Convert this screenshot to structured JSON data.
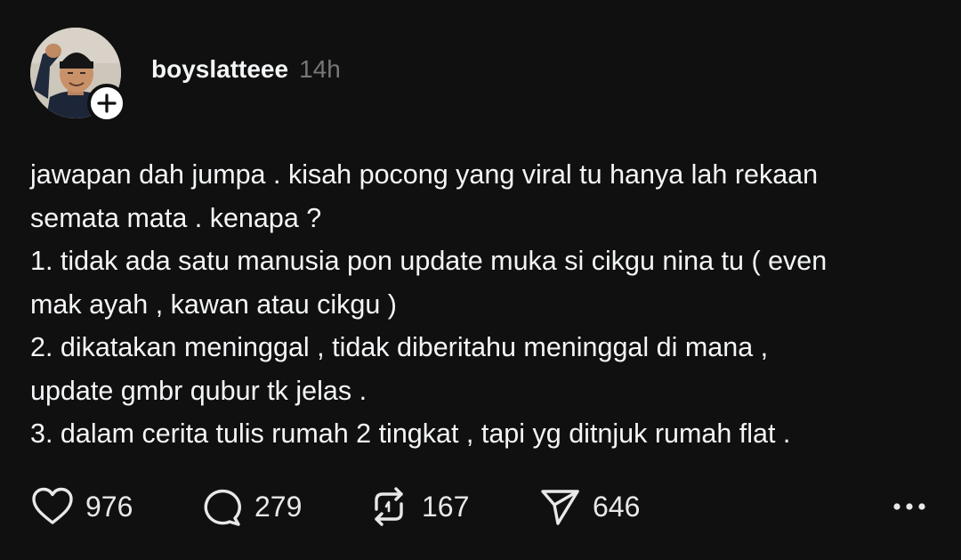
{
  "post": {
    "author": {
      "username": "boyslatteee",
      "time": "14h",
      "avatar_icon": "profile-photo",
      "follow_icon": "plus-icon"
    },
    "content": {
      "lines": [
        "jawapan dah jumpa . kisah pocong yang viral tu hanya lah rekaan",
        "semata mata . kenapa ?",
        "1. tidak ada satu manusia pon update muka si cikgu nina tu ( even",
        "mak ayah , kawan atau cikgu )",
        "2. dikatakan meninggal , tidak diberitahu meninggal di mana ,",
        "update gmbr qubur tk jelas .",
        "3. dalam cerita tulis rumah 2 tingkat , tapi yg ditnjuk rumah flat ."
      ]
    },
    "actions": {
      "likes": "976",
      "replies": "279",
      "reposts": "167",
      "shares": "646",
      "like_icon": "heart-icon",
      "reply_icon": "comment-icon",
      "repost_icon": "repost-icon",
      "share_icon": "send-icon",
      "more_icon": "more-horizontal-icon"
    }
  },
  "colors": {
    "background": "#101010",
    "text": "#f3f5f7",
    "muted": "#777777",
    "icon": "#e8e8e8"
  }
}
